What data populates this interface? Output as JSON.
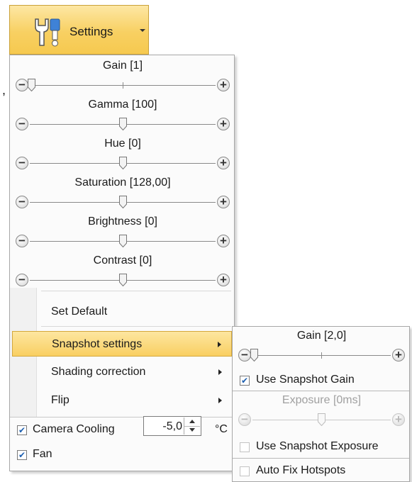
{
  "ribbon": {
    "settings_label": "Settings",
    "icon": "wrench-icon"
  },
  "stray_text": ",",
  "sliders": [
    {
      "label": "Gain [1]",
      "value_fraction": 0.0
    },
    {
      "label": "Gamma [100]",
      "value_fraction": 0.5
    },
    {
      "label": "Hue [0]",
      "value_fraction": 0.5
    },
    {
      "label": "Saturation [128,00]",
      "value_fraction": 0.5
    },
    {
      "label": "Brightness [0]",
      "value_fraction": 0.5
    },
    {
      "label": "Contrast [0]",
      "value_fraction": 0.5
    }
  ],
  "menu_items": [
    {
      "label": "Set Default",
      "has_submenu": false,
      "active": false
    },
    {
      "label": "Snapshot settings",
      "has_submenu": true,
      "active": true
    },
    {
      "label": "Shading correction",
      "has_submenu": true,
      "active": false
    },
    {
      "label": "Flip",
      "has_submenu": true,
      "active": false
    }
  ],
  "camera_cooling": {
    "label": "Camera Cooling",
    "checked": true,
    "value": "-5,0",
    "unit": "°C"
  },
  "fan": {
    "label": "Fan",
    "checked": true
  },
  "snapshot_submenu": {
    "gain_label": "Gain [2,0]",
    "gain_fraction": 0.0,
    "use_snapshot_gain": {
      "label": "Use Snapshot Gain",
      "checked": true
    },
    "exposure_label": "Exposure [0ms]",
    "exposure_fraction": 0.5,
    "use_snapshot_exposure": {
      "label": "Use Snapshot Exposure",
      "checked": false
    },
    "auto_fix_hotspots": {
      "label": "Auto Fix Hotspots",
      "checked": false
    }
  },
  "colors": {
    "accent_hover": "#f9cf62",
    "check_blue": "#1c5fb0"
  }
}
